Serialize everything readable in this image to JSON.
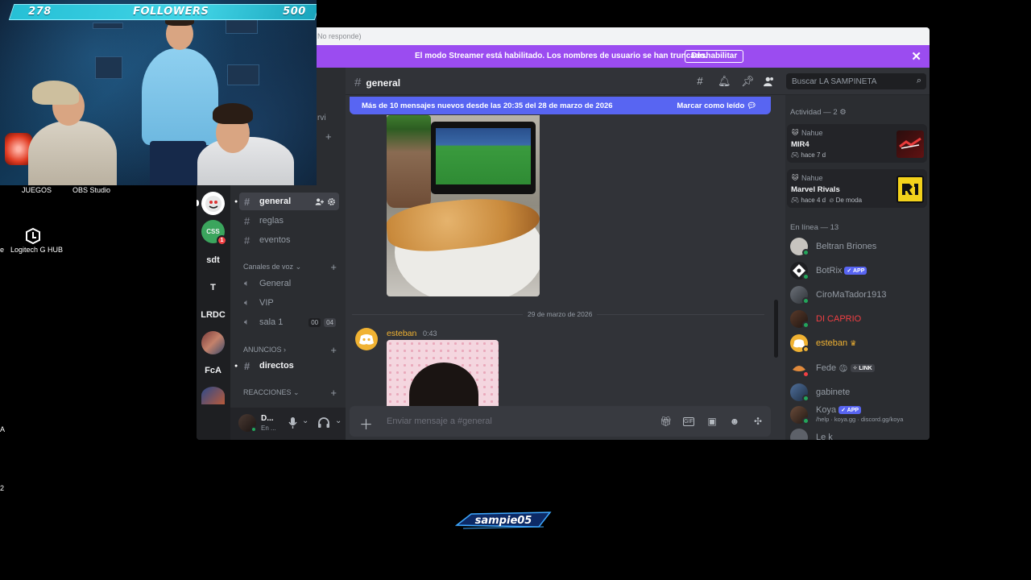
{
  "overlay": {
    "followers_current": "278",
    "followers_label": "FOLLOWERS",
    "followers_goal": "500"
  },
  "desktop": {
    "icons": [
      "JUEGOS",
      "OBS Studio",
      "Logitech G HUB"
    ],
    "edge_marks": [
      "e",
      "A",
      "2"
    ]
  },
  "titlebar": {
    "text": "No responde)"
  },
  "streamer_banner": {
    "message": "El modo Streamer está habilitado. Los nombres de usuario se han truncado.",
    "button": "Deshabilitar",
    "close": "✕"
  },
  "guilds": [
    {
      "label": "",
      "badge": ""
    },
    {
      "label": "CSS",
      "badge": "1"
    },
    {
      "label": "sdt"
    },
    {
      "label": "T"
    },
    {
      "label": "LRDC"
    },
    {
      "label": ""
    },
    {
      "label": "FcA"
    },
    {
      "label": ""
    }
  ],
  "channels": {
    "partial_top": "rvi",
    "items": [
      {
        "name": "general"
      },
      {
        "name": "reglas"
      },
      {
        "name": "eventos"
      }
    ],
    "voice_category": "Canales de voz",
    "voice": [
      {
        "name": "General"
      },
      {
        "name": "VIP"
      },
      {
        "name": "sala 1",
        "b1": "00",
        "b2": "04"
      }
    ],
    "cat_anuncios": "ANUNCIOS",
    "anuncios_item": "directos",
    "cat_reacciones": "REACCIONES"
  },
  "user": {
    "name": "D...",
    "status": "En ..."
  },
  "main": {
    "channel_title": "general",
    "search_placeholder": "Buscar LA SAMPINETA",
    "new_messages": "Más de 10 mensajes nuevos desde las 20:35 del 28 de marzo de 2026",
    "mark_read": "Marcar como leído",
    "date_divider": "29 de marzo de 2026",
    "message": {
      "author": "esteban",
      "time": "0:43"
    },
    "composer_placeholder": "Enviar mensaje a #general"
  },
  "members": {
    "activity_header": "Actividad — 2",
    "activities": [
      {
        "user": "Nahue",
        "game": "MIR4",
        "meta": "hace 7 d"
      },
      {
        "user": "Nahue",
        "game": "Marvel Rivals",
        "meta": "hace 4 d",
        "trend": "De moda"
      }
    ],
    "online_header": "En línea — 13",
    "list": [
      {
        "name": "Beltran Briones"
      },
      {
        "name": "BotRix",
        "tag": "APP"
      },
      {
        "name": "CiroMaTador1913"
      },
      {
        "name": "DI CAPRIO"
      },
      {
        "name": "esteban"
      },
      {
        "name": "Fede",
        "tag": "LINK"
      },
      {
        "name": "gabinete"
      },
      {
        "name": "Koya",
        "tag": "APP",
        "sub": "/help · koya.gg · discord.gg/koya"
      },
      {
        "name": "Le k"
      }
    ]
  },
  "watermark": {
    "text": "sampie05"
  },
  "colors": {
    "streamer_banner": "#9b4cf0",
    "blurple": "#5865f2",
    "online": "#23a55a",
    "dicaprio": "#f23f43",
    "esteban": "#f0b232",
    "follower_bar": "#41d4e6"
  }
}
